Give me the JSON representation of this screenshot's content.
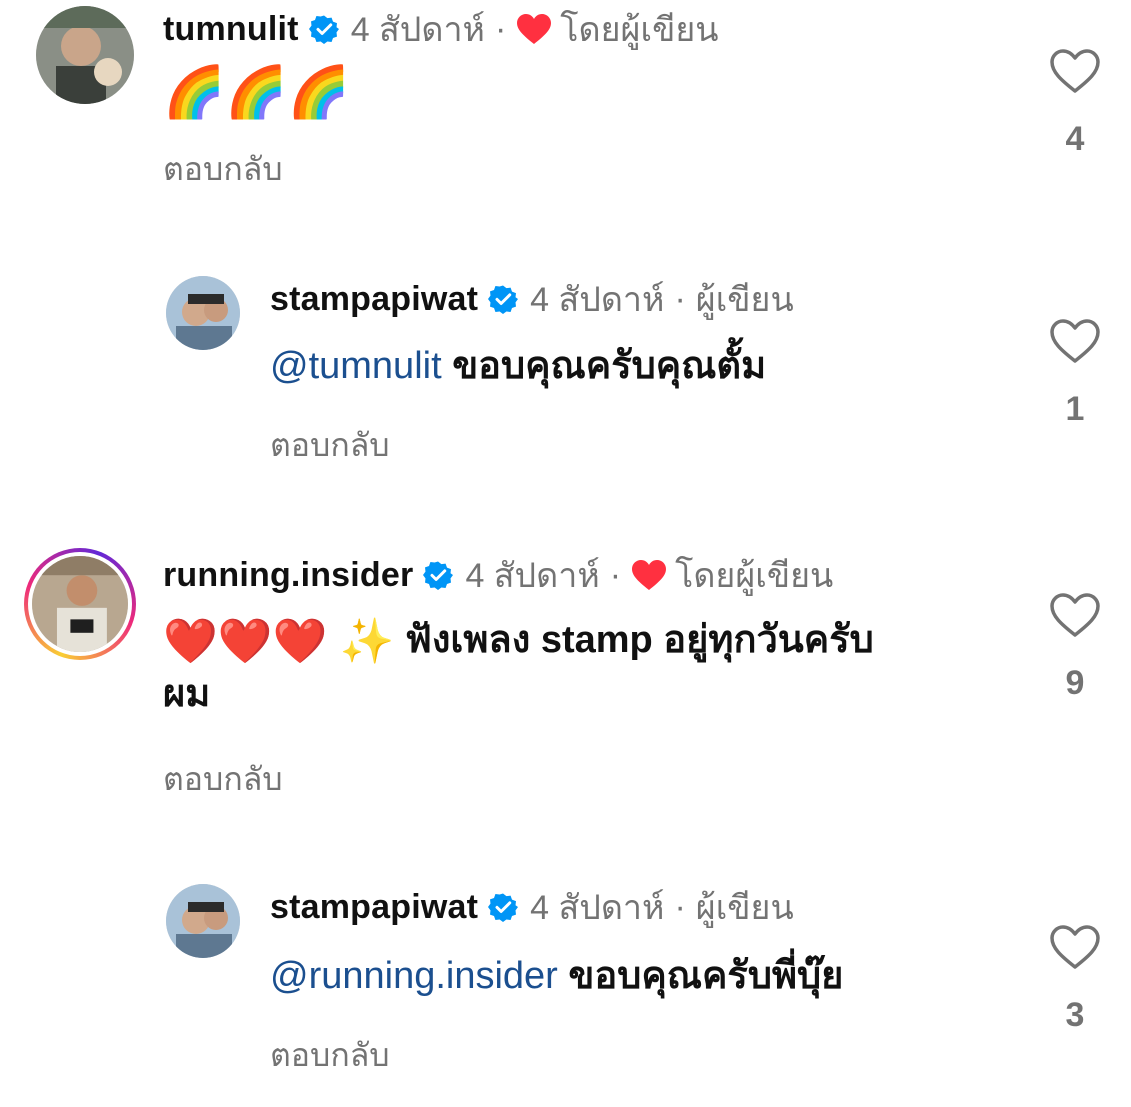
{
  "colors": {
    "verified": "#0095f6",
    "author_heart": "#ff3040",
    "mention": "#1b4f8f",
    "muted": "#737373"
  },
  "comments": [
    {
      "username": "tumnulit",
      "time": "4 สัปดาห์",
      "dot": "·",
      "author_label": "โดยผู้เขียน",
      "author_liked": true,
      "text": "",
      "emojis": "🌈🌈🌈",
      "reply_label": "ตอบกลับ",
      "like_count": "4",
      "avatar_icon": "avatar-photo"
    },
    {
      "username": "stampapiwat",
      "time": "4 สัปดาห์",
      "dot": "·",
      "author_label": "ผู้เขียน",
      "mention": "@tumnulit",
      "text": "ขอบคุณครับคุณตั้ม",
      "reply_label": "ตอบกลับ",
      "like_count": "1",
      "avatar_icon": "avatar-photo"
    },
    {
      "username": "running.insider",
      "time": "4 สัปดาห์",
      "dot": "·",
      "author_label": "โดยผู้เขียน",
      "author_liked": true,
      "emojis": "❤️❤️❤️ ✨",
      "text_line1": "ฟังเพลง stamp อยู่ทุกวันครับ",
      "text_line2": "ผม",
      "reply_label": "ตอบกลับ",
      "like_count": "9",
      "avatar_icon": "avatar-photo-story"
    },
    {
      "username": "stampapiwat",
      "time": "4 สัปดาห์",
      "dot": "·",
      "author_label": "ผู้เขียน",
      "mention": "@running.insider",
      "text": "ขอบคุณครับพี่บุ๊ย",
      "reply_label": "ตอบกลับ",
      "like_count": "3",
      "avatar_icon": "avatar-photo"
    }
  ]
}
